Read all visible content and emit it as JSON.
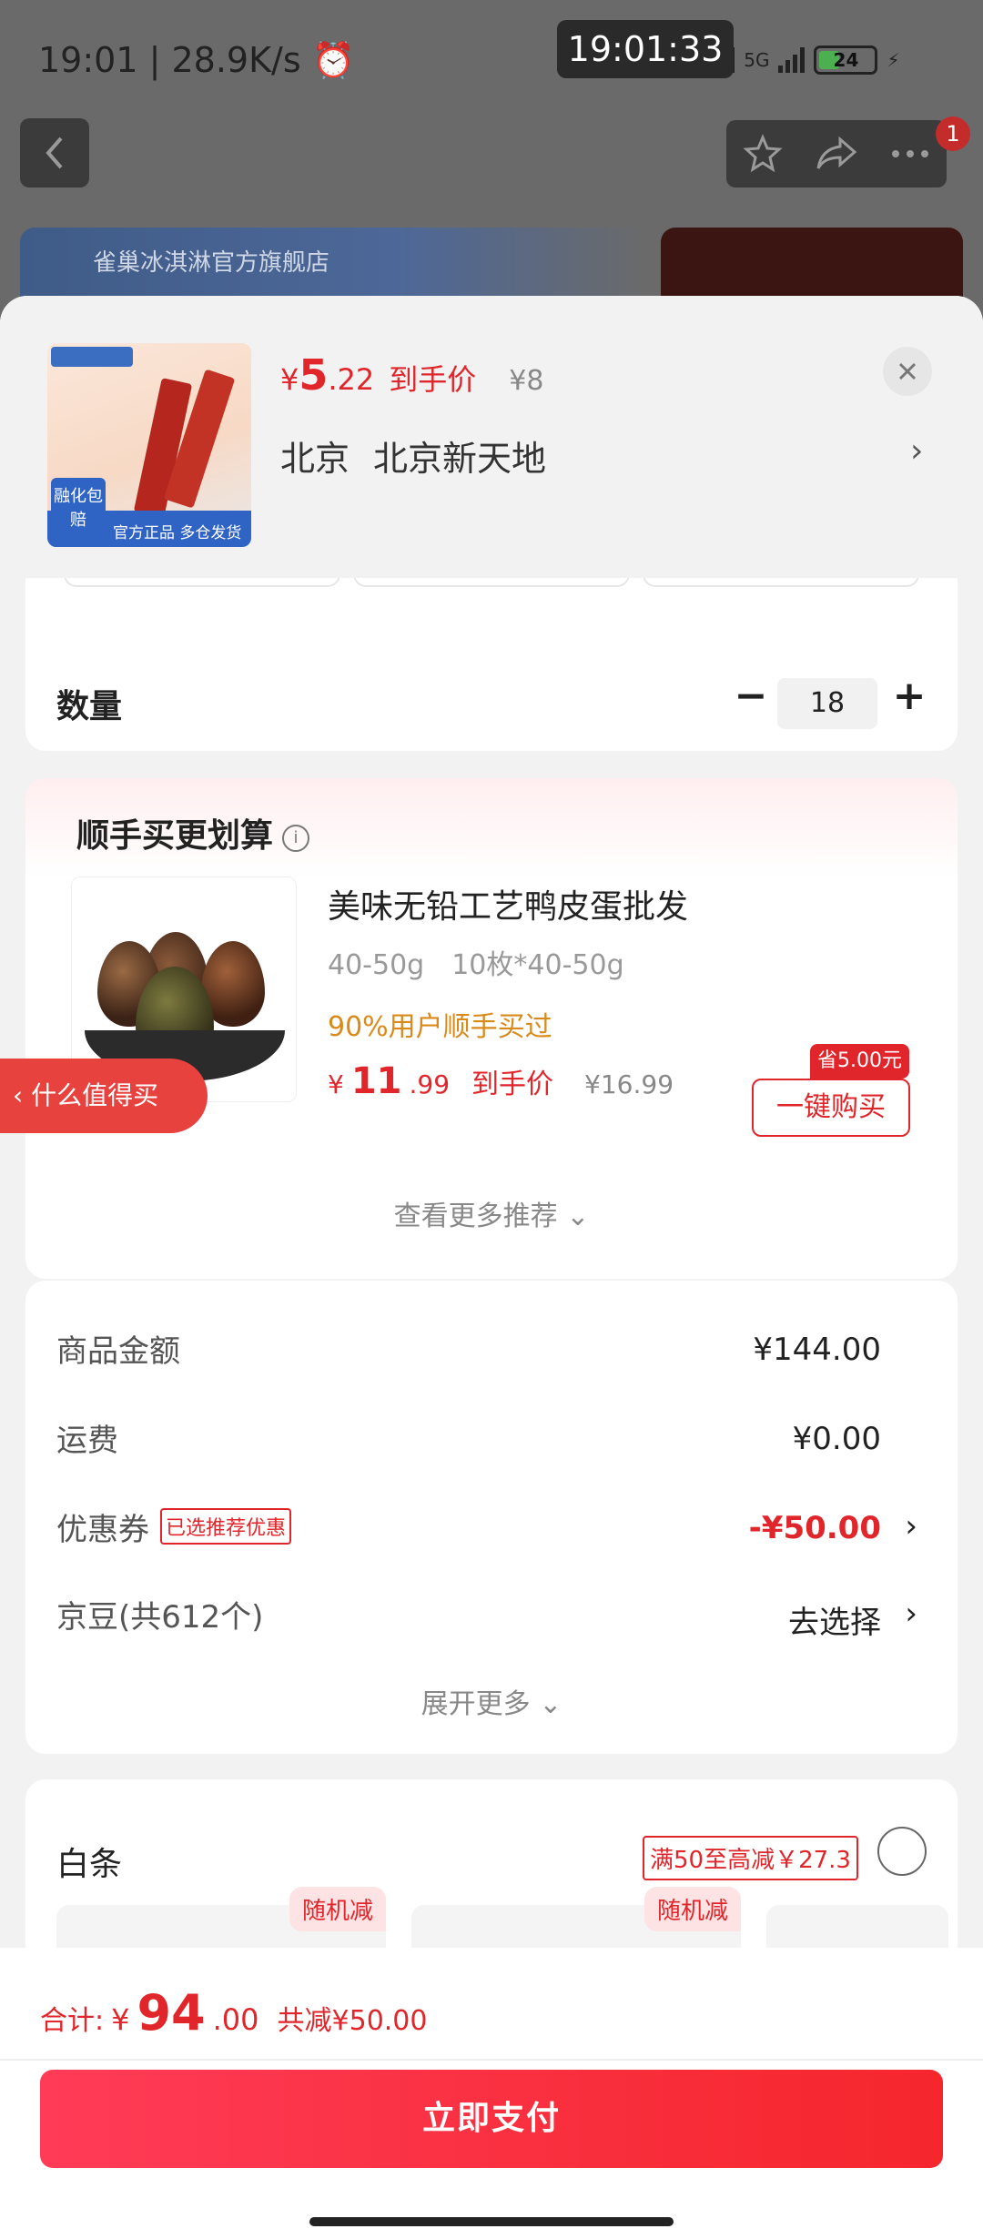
{
  "status_bar": {
    "time": "19:01",
    "speed": "28.9K/s",
    "clock_overlay": "19:01:33",
    "network": "5G",
    "battery": "24"
  },
  "top_bar": {
    "notification_count": "1",
    "banner_text": "雀巢冰淇淋官方旗舰店"
  },
  "product": {
    "price_currency": "¥",
    "price_int": "5",
    "price_dec": ".22",
    "price_label": "到手价",
    "original_price": "¥8",
    "address_city": "北京",
    "address_detail": "北京新天地",
    "thumb_badge": "融化包赔",
    "thumb_bottom": "官方正品 多仓发货"
  },
  "quantity": {
    "label": "数量",
    "value": "18"
  },
  "float_tag": "什么值得买",
  "recommend": {
    "title": "顺手买更划算",
    "item_name": "美味无铅工艺鸭皮蛋批发",
    "spec1": "40-50g",
    "spec2": "10枚*40-50g",
    "note": "90%用户顺手买过",
    "price_currency": "¥",
    "price_int": "11",
    "price_dec": ".99",
    "price_label": "到手价",
    "original_price": "¥16.99",
    "save_tag": "省5.00元",
    "buy_label": "一键购买",
    "more_label": "查看更多推荐"
  },
  "summary": {
    "goods_label": "商品金额",
    "goods_value": "¥144.00",
    "shipping_label": "运费",
    "shipping_value": "¥0.00",
    "coupon_label": "优惠券",
    "coupon_tag": "已选推荐优惠",
    "coupon_value": "-¥50.00",
    "jingdou_label": "京豆(共612个)",
    "jingdou_value": "去选择",
    "expand_label": "展开更多"
  },
  "payment": {
    "baitiao_label": "白条",
    "baitiao_tag": "满50至高减￥27.3",
    "plan_tag": "随机减"
  },
  "bottom": {
    "total_label": "合计:",
    "total_currency": "¥",
    "total_int": "94",
    "total_dec": ".00",
    "discount_label": "共减¥50.00",
    "pay_button": "立即支付"
  },
  "colors": {
    "accent_red": "#e0262b",
    "note_orange": "#d98a1a"
  }
}
